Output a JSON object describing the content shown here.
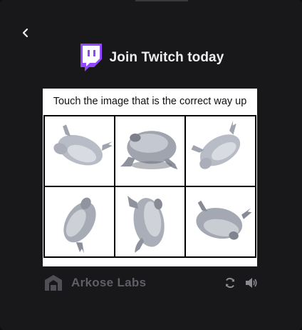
{
  "header": {
    "title": "Join Twitch today",
    "brand_color": "#9146ff"
  },
  "challenge": {
    "instruction": "Touch the image that is the correct way up",
    "tiles": [
      {
        "icon": "frog-figure-icon",
        "orientation": "rotated"
      },
      {
        "icon": "frog-figure-icon",
        "orientation": "upright"
      },
      {
        "icon": "frog-figure-icon",
        "orientation": "rotated"
      },
      {
        "icon": "frog-figure-icon",
        "orientation": "rotated"
      },
      {
        "icon": "frog-figure-icon",
        "orientation": "rotated"
      },
      {
        "icon": "frog-figure-icon",
        "orientation": "upside-down"
      }
    ]
  },
  "footer": {
    "brand": "Arkose Labs",
    "reload_icon": "reload-icon",
    "audio_icon": "speaker-icon"
  }
}
